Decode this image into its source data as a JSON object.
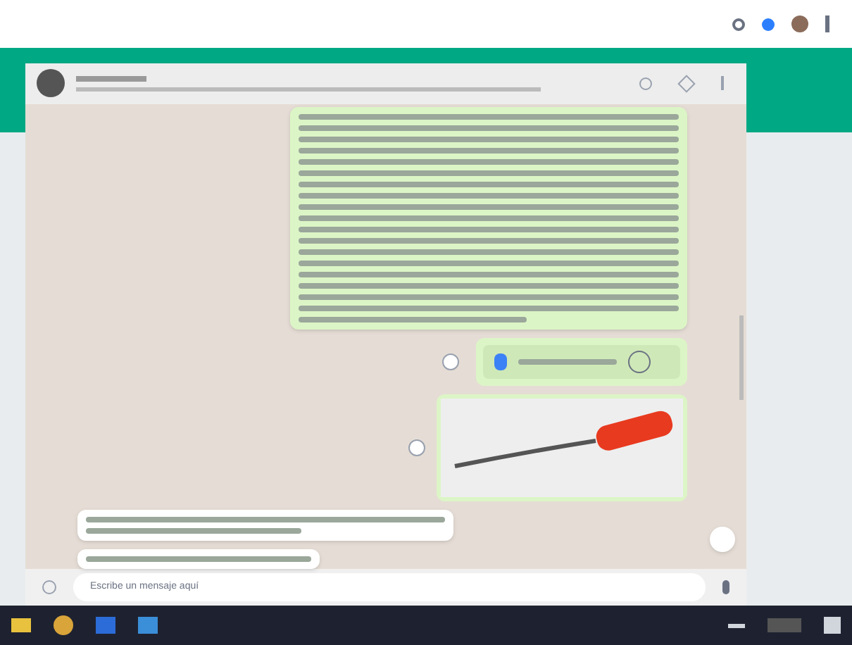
{
  "chat": {
    "messages": [
      {
        "kind": "paragraph",
        "outgoing": true
      },
      {
        "kind": "document",
        "outgoing": true
      },
      {
        "kind": "image",
        "outgoing": true
      },
      {
        "kind": "reply",
        "outgoing": false
      },
      {
        "kind": "preview",
        "outgoing": false
      }
    ]
  },
  "composer": {
    "placeholder": "Escribe un mensaje aquí"
  }
}
